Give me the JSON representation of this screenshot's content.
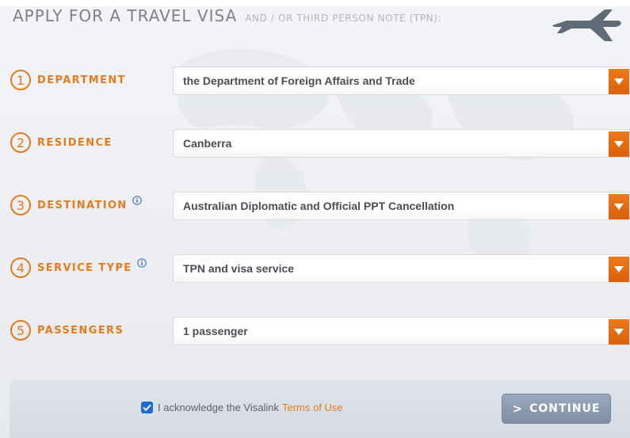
{
  "header": {
    "title": "APPLY FOR A TRAVEL VISA",
    "subtitle": "AND / OR THIRD PERSON NOTE (TPN):"
  },
  "icons": {
    "plane": "airplane-icon",
    "info": "info-icon",
    "caret": "chevron-down-icon",
    "checkbox": "checkmark-icon"
  },
  "colors": {
    "accent": "#e47c1e",
    "caret_bg": "#e06a12",
    "button": "#8797ad",
    "checkbox": "#1f6ccd"
  },
  "steps": [
    {
      "number": "1",
      "label": "DEPARTMENT",
      "value": "the Department of Foreign Affairs and Trade",
      "info": false
    },
    {
      "number": "2",
      "label": "RESIDENCE",
      "value": "Canberra",
      "info": false
    },
    {
      "number": "3",
      "label": "DESTINATION",
      "value": "Australian Diplomatic and Official PPT Cancellation",
      "info": true
    },
    {
      "number": "4",
      "label": "SERVICE TYPE",
      "value": "TPN and visa service",
      "info": true
    },
    {
      "number": "5",
      "label": "PASSENGERS",
      "value": "1 passenger",
      "info": false
    }
  ],
  "footer": {
    "acknowledge_text": "I acknowledge the Visalink",
    "terms_link": "Terms of Use",
    "checked": true,
    "continue_label": "CONTINUE",
    "continue_chevron": ">"
  }
}
